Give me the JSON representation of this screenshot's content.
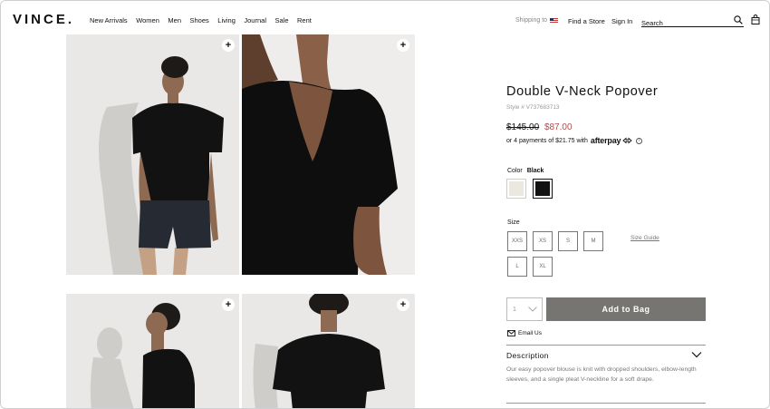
{
  "header": {
    "logo": "VINCE.",
    "nav": [
      "New Arrivals",
      "Women",
      "Men",
      "Shoes",
      "Living",
      "Journal",
      "Sale",
      "Rent"
    ],
    "shipping_label": "Shipping to",
    "find_store": "Find a Store",
    "sign_in": "Sign In",
    "search_placeholder": "Search"
  },
  "gallery": {
    "zoom_label": "+"
  },
  "product": {
    "title": "Double V-Neck Popover",
    "style": "Style # V737683713",
    "price_original": "$145.00",
    "price_sale": "$87.00",
    "installments": "or 4 payments of $21.75 with",
    "afterpay_logo": "afterpay",
    "color_label": "Color",
    "color_selected": "Black",
    "swatches": [
      {
        "name": "Ivory",
        "hex": "#ebe8df"
      },
      {
        "name": "Black",
        "hex": "#111111"
      }
    ],
    "size_label": "Size",
    "sizes": [
      "XXS",
      "XS",
      "S",
      "M",
      "L",
      "XL"
    ],
    "size_guide": "Size Guide",
    "quantity": "1",
    "add_to_bag": "Add to Bag",
    "email_us": "Email Us",
    "description_title": "Description",
    "description_body": "Our easy popover blouse is knit with dropped shoulders, elbow-length sleeves, and a single pleat V-neckline for a soft drape."
  },
  "colors": {
    "accent_sale": "#b24a4a",
    "button_bg": "#777571"
  }
}
